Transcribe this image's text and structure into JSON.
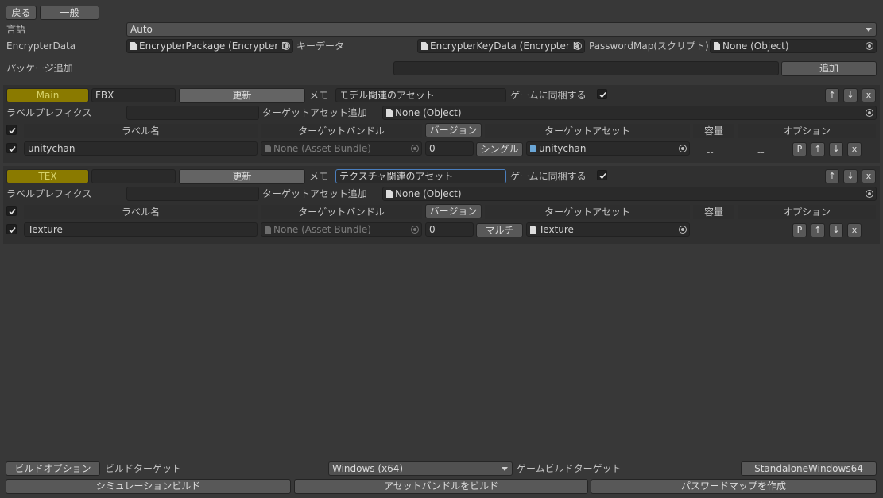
{
  "toolbar": {
    "back": "戻る",
    "general": "一般"
  },
  "settings": {
    "language_label": "言語",
    "language_value": "Auto",
    "encrypter_data_label": "EncrypterData",
    "encrypter_package": "EncrypterPackage (Encrypter D",
    "key_data_label": "キーデータ",
    "key_data_value": "EncrypterKeyData (Encrypter K",
    "password_map_label": "PasswordMap(スクリプト)",
    "password_map_value": "None (Object)"
  },
  "package_add": {
    "label": "パッケージ追加",
    "value": "",
    "button": "追加"
  },
  "columns": {
    "label_name": "ラベル名",
    "target_bundle": "ターゲットバンドル",
    "version": "バージョン",
    "target_asset": "ターゲットアセット",
    "capacity": "容量",
    "options": "オプション"
  },
  "common": {
    "memo": "メモ",
    "sync_game": "ゲームに同梱する",
    "label_prefix": "ラベルプレフィクス",
    "target_asset_add": "ターゲットアセット追加",
    "update": "更新",
    "none_object": "None (Object)",
    "none_bundle": "None (Asset Bundle)",
    "up": "↑",
    "down": "↓",
    "close": "x",
    "p": "P",
    "dash": "--"
  },
  "groups": [
    {
      "tag": "Main",
      "name": "FBX",
      "memo": "モデル関連のアセット",
      "row": {
        "label": "unitychan",
        "version": "0",
        "mode": "シングル",
        "asset": "unitychan"
      }
    },
    {
      "tag": "TEX",
      "name": "",
      "memo": "テクスチャ関連のアセット",
      "row": {
        "label": "Texture",
        "version": "0",
        "mode": "マルチ",
        "asset": "Texture"
      }
    }
  ],
  "footer": {
    "build_options": "ビルドオプション",
    "build_target_label": "ビルドターゲット",
    "build_target_value": "Windows (x64)",
    "game_build_target_label": "ゲームビルドターゲット",
    "game_build_target_value": "StandaloneWindows64",
    "simulation_build": "シミュレーションビルド",
    "asset_bundle_build": "アセットバンドルをビルド",
    "create_password_map": "パスワードマップを作成"
  },
  "colors": {
    "background": "#383838",
    "tag": "#8a7a00",
    "focus": "#4a7ebd"
  }
}
